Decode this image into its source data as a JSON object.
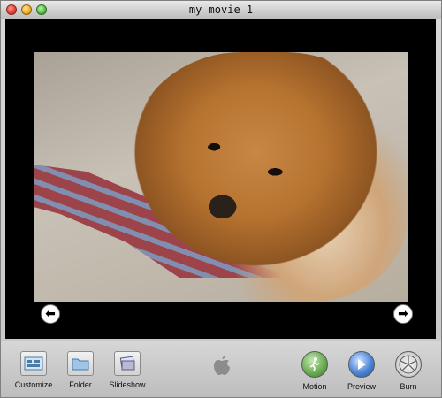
{
  "window": {
    "title": "my movie 1"
  },
  "toolbar": {
    "customize_label": "Customize",
    "folder_label": "Folder",
    "slideshow_label": "Slideshow",
    "motion_label": "Motion",
    "preview_label": "Preview",
    "burn_label": "Burn"
  },
  "colors": {
    "stage_background": "#000000",
    "toolbar_background": "#c8c8c8"
  },
  "icons": {
    "nav_left": "left-arrow-icon",
    "nav_right": "right-arrow-icon",
    "customize": "customize-icon",
    "folder": "folder-icon",
    "slideshow": "slideshow-icon",
    "apple": "apple-logo-icon",
    "motion": "motion-icon",
    "preview": "play-icon",
    "burn": "burn-icon"
  }
}
